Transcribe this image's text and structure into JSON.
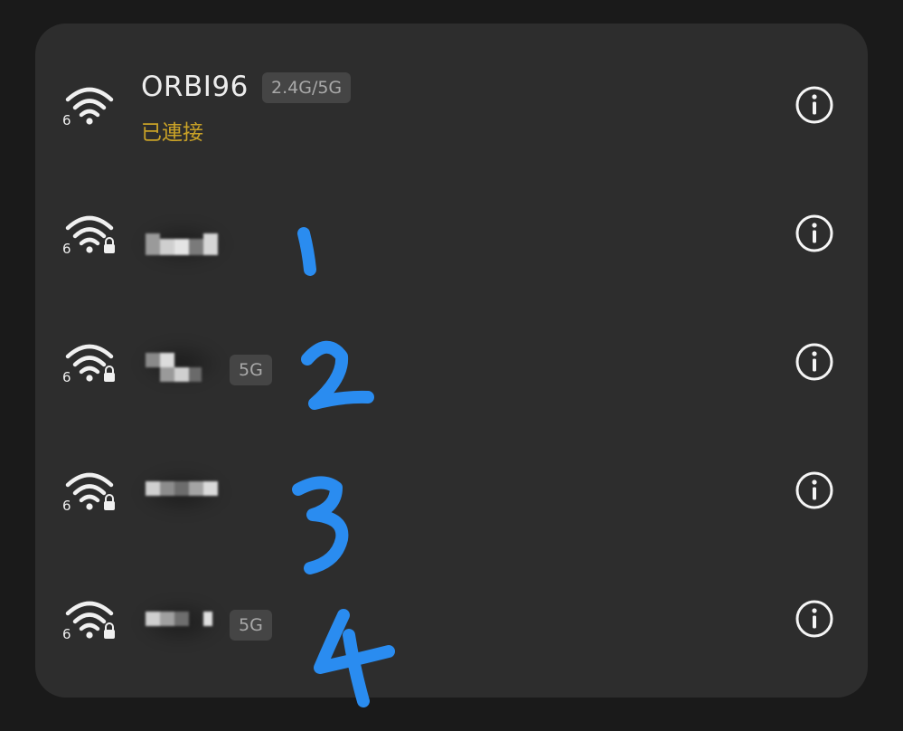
{
  "networks": [
    {
      "ssid": "ORBI96",
      "band": "2.4G/5G",
      "status": "已連接"
    },
    {
      "ssid": "",
      "band": ""
    },
    {
      "ssid": "",
      "band": "5G"
    },
    {
      "ssid": "",
      "band": ""
    },
    {
      "ssid": "",
      "band": "5G"
    }
  ],
  "annotations": [
    "1",
    "2",
    "3",
    "4"
  ],
  "colors": {
    "background": "#1a1a1a",
    "panel": "#2d2d2d",
    "connected_status": "#c9a227",
    "annotation": "#2a8cf0"
  }
}
